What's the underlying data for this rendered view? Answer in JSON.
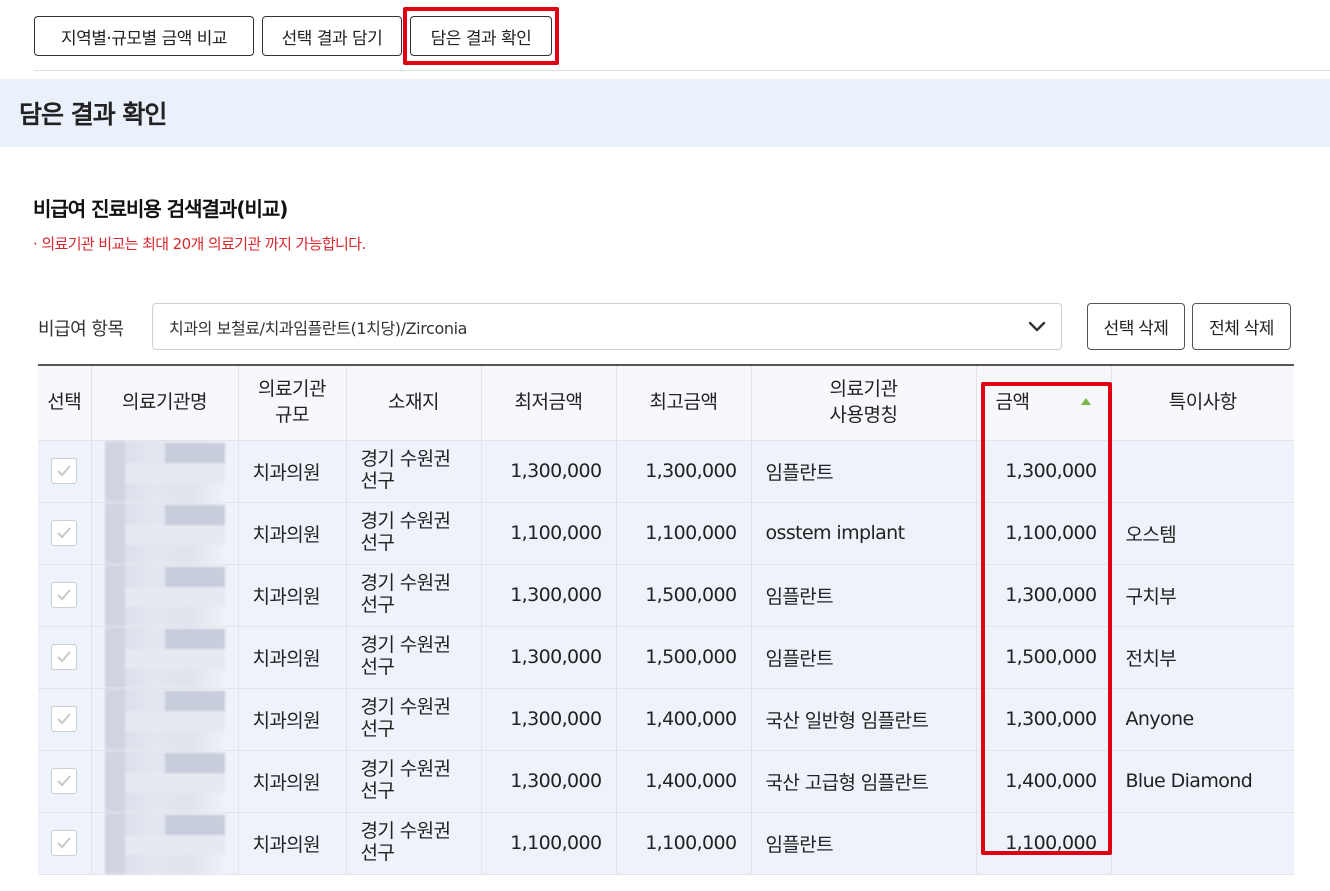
{
  "tabs": [
    {
      "label": "지역별·규모별 금액 비교"
    },
    {
      "label": "선택 결과 담기"
    },
    {
      "label": "담은 결과 확인"
    }
  ],
  "banner_title": "담은 결과 확인",
  "section": {
    "title": "비급여 진료비용 검색결과(비교)",
    "note": "· 의료기관 비교는 최대 20개 의료기관 까지 가능합니다."
  },
  "filter": {
    "label": "비급여 항목",
    "selected": "치과의 보철료/치과임플란트(1치당)/Zirconia"
  },
  "actions": {
    "delete_selected": "선택 삭제",
    "delete_all": "전체 삭제"
  },
  "columns": {
    "select": "선택",
    "name": "의료기관명",
    "scale_1": "의료기관",
    "scale_2": "규모",
    "location": "소재지",
    "min": "최저금액",
    "max": "최고금액",
    "usage_1": "의료기관",
    "usage_2": "사용명칭",
    "amount": "금액",
    "remarks": "특이사항"
  },
  "rows": [
    {
      "scale": "치과의원",
      "loc1": "경기 수원권",
      "loc2": "선구",
      "min": "1,300,000",
      "max": "1,300,000",
      "usage": "임플란트",
      "amount": "1,300,000",
      "remarks": ""
    },
    {
      "scale": "치과의원",
      "loc1": "경기 수원권",
      "loc2": "선구",
      "min": "1,100,000",
      "max": "1,100,000",
      "usage": "osstem implant",
      "amount": "1,100,000",
      "remarks": "오스템"
    },
    {
      "scale": "치과의원",
      "loc1": "경기 수원권",
      "loc2": "선구",
      "min": "1,300,000",
      "max": "1,500,000",
      "usage": "임플란트",
      "amount": "1,300,000",
      "remarks": "구치부"
    },
    {
      "scale": "치과의원",
      "loc1": "경기 수원권",
      "loc2": "선구",
      "min": "1,300,000",
      "max": "1,500,000",
      "usage": "임플란트",
      "amount": "1,500,000",
      "remarks": "전치부"
    },
    {
      "scale": "치과의원",
      "loc1": "경기 수원권",
      "loc2": "선구",
      "min": "1,300,000",
      "max": "1,400,000",
      "usage": "국산 일반형 임플란트",
      "amount": "1,300,000",
      "remarks": "Anyone"
    },
    {
      "scale": "치과의원",
      "loc1": "경기 수원권",
      "loc2": "선구",
      "min": "1,300,000",
      "max": "1,400,000",
      "usage": "국산 고급형 임플란트",
      "amount": "1,400,000",
      "remarks": "Blue Diamond"
    },
    {
      "scale": "치과의원",
      "loc1": "경기 수원권",
      "loc2": "선구",
      "min": "1,100,000",
      "max": "1,100,000",
      "usage": "임플란트",
      "amount": "1,100,000",
      "remarks": ""
    }
  ],
  "colors": {
    "highlight": "#e00012",
    "banner_bg": "#eaf1fb",
    "row_bg": "#eef3fb",
    "note_red": "#d9272e",
    "sort_green": "#7bb84a"
  }
}
